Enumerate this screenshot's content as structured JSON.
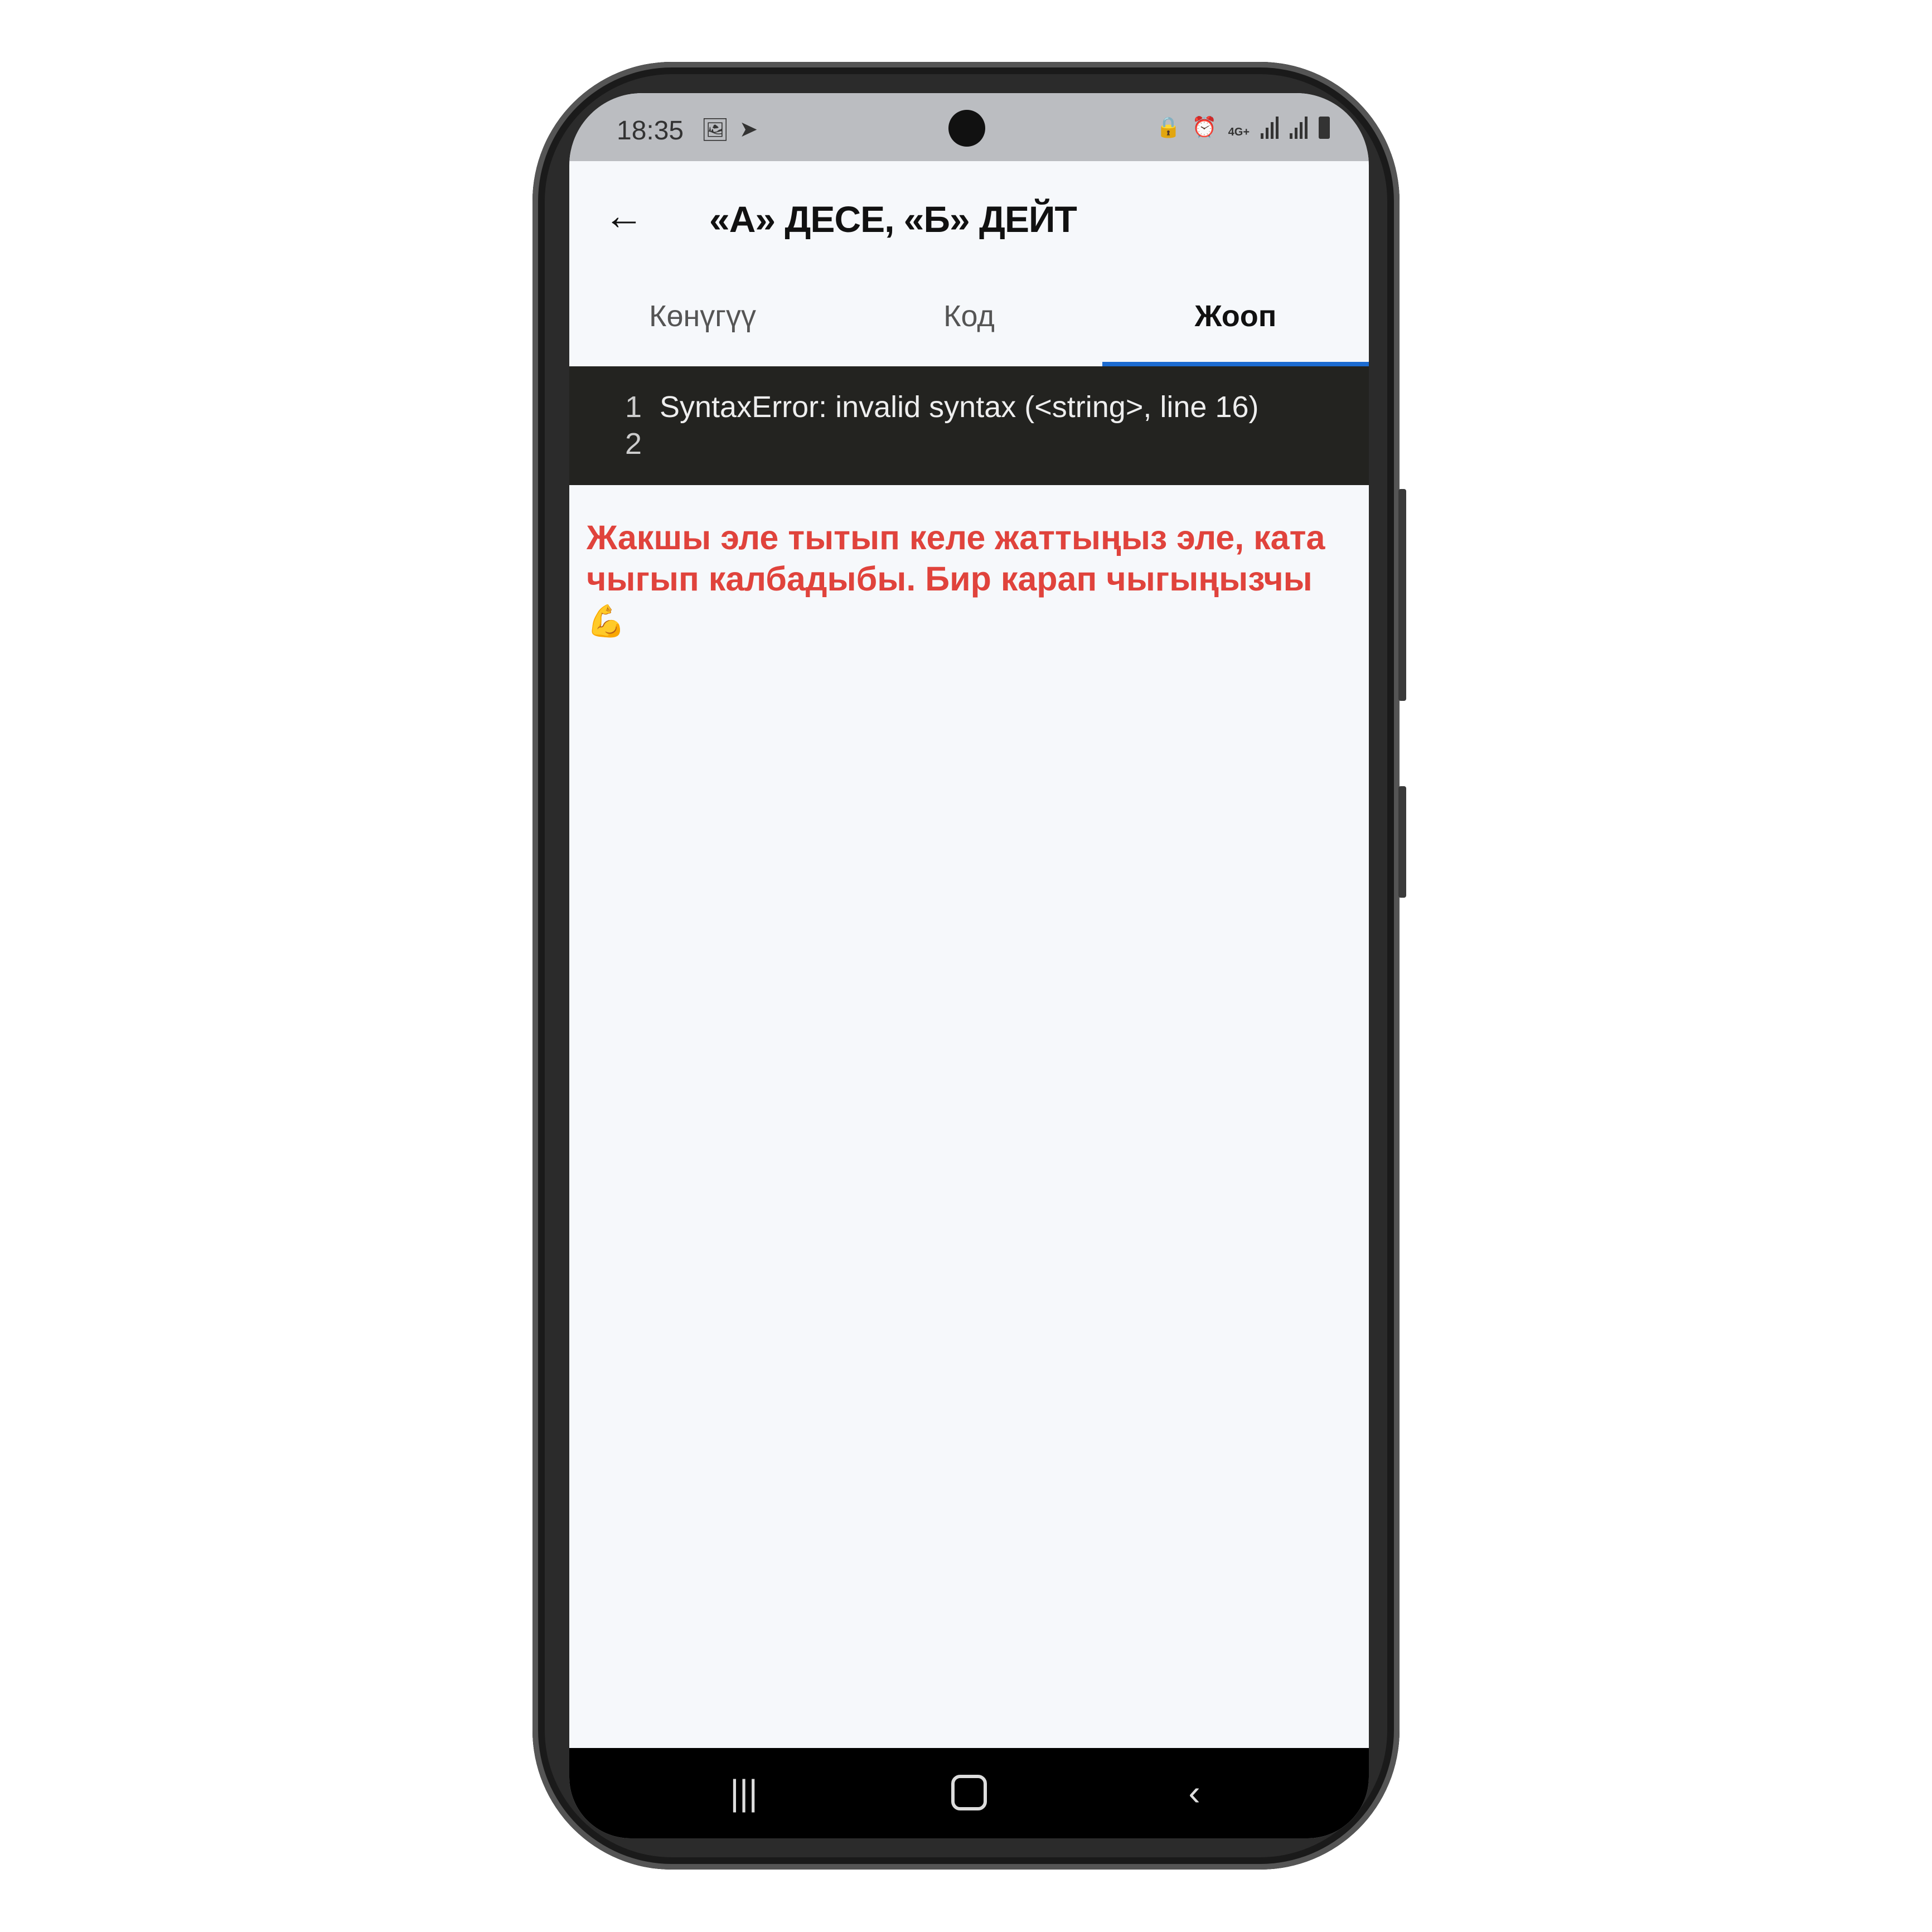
{
  "status_bar": {
    "time": "18:35",
    "left_icons": [
      "image-icon",
      "telegram-icon"
    ],
    "right_icons": [
      "lock-icon",
      "alarm-icon",
      "4g-plus-icon",
      "signal-icon",
      "signal-icon",
      "battery-icon"
    ],
    "network_label": "4G+"
  },
  "app_bar": {
    "back_icon": "arrow-left-icon",
    "title": "«А» ДЕСЕ, «Б» ДЕЙТ"
  },
  "tabs": [
    {
      "label": "Көнүгүү",
      "active": false
    },
    {
      "label": "Код",
      "active": false
    },
    {
      "label": "Жооп",
      "active": true
    }
  ],
  "console": {
    "lines": [
      {
        "number": "1",
        "text": "SyntaxError: invalid syntax (<string>, line 16)"
      },
      {
        "number": "2",
        "text": ""
      }
    ]
  },
  "feedback": {
    "message": "Жакшы эле тытып келе жаттыңыз эле, ката чыгып калбадыбы. Бир карап чыгыңызчы",
    "emoji": "💪",
    "color": "#e0433c"
  },
  "colors": {
    "accent": "#1c6bd0",
    "console_bg": "#232320"
  },
  "nav_bar": [
    "recents-icon",
    "home-icon",
    "back-icon"
  ]
}
